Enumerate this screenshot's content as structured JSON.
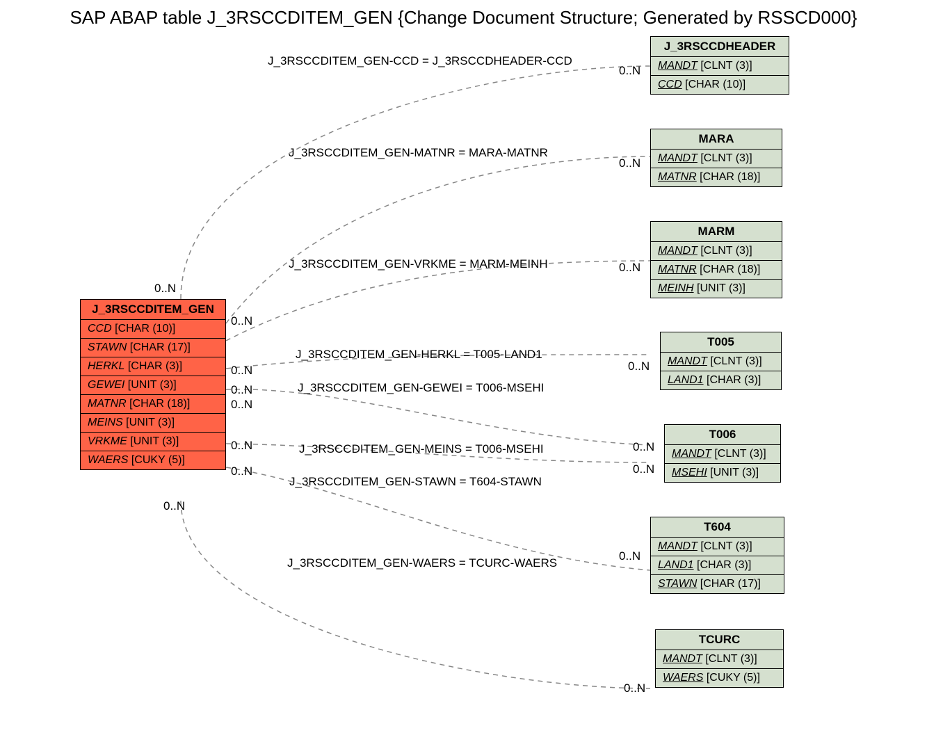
{
  "title": "SAP ABAP table J_3RSCCDITEM_GEN {Change Document Structure; Generated by RSSCD000}",
  "main": {
    "name": "J_3RSCCDITEM_GEN",
    "rows": [
      {
        "f": "CCD",
        "t": "[CHAR (10)]"
      },
      {
        "f": "STAWN",
        "t": "[CHAR (17)]"
      },
      {
        "f": "HERKL",
        "t": "[CHAR (3)]"
      },
      {
        "f": "GEWEI",
        "t": "[UNIT (3)]"
      },
      {
        "f": "MATNR",
        "t": "[CHAR (18)]"
      },
      {
        "f": "MEINS",
        "t": "[UNIT (3)]"
      },
      {
        "f": "VRKME",
        "t": "[UNIT (3)]"
      },
      {
        "f": "WAERS",
        "t": "[CUKY (5)]"
      }
    ]
  },
  "refs": [
    {
      "name": "J_3RSCCDHEADER",
      "rows": [
        {
          "f": "MANDT",
          "t": "[CLNT (3)]",
          "u": true
        },
        {
          "f": "CCD",
          "t": "[CHAR (10)]",
          "u": true
        }
      ]
    },
    {
      "name": "MARA",
      "rows": [
        {
          "f": "MANDT",
          "t": "[CLNT (3)]",
          "i": true,
          "u": true
        },
        {
          "f": "MATNR",
          "t": "[CHAR (18)]",
          "u": true
        }
      ]
    },
    {
      "name": "MARM",
      "rows": [
        {
          "f": "MANDT",
          "t": "[CLNT (3)]",
          "i": true,
          "u": true
        },
        {
          "f": "MATNR",
          "t": "[CHAR (18)]",
          "i": true,
          "u": true
        },
        {
          "f": "MEINH",
          "t": "[UNIT (3)]",
          "i": true,
          "u": true
        }
      ]
    },
    {
      "name": "T005",
      "rows": [
        {
          "f": "MANDT",
          "t": "[CLNT (3)]",
          "i": true,
          "u": true
        },
        {
          "f": "LAND1",
          "t": "[CHAR (3)]",
          "u": true
        }
      ]
    },
    {
      "name": "T006",
      "rows": [
        {
          "f": "MANDT",
          "t": "[CLNT (3)]",
          "i": true,
          "u": true
        },
        {
          "f": "MSEHI",
          "t": "[UNIT (3)]",
          "u": true
        }
      ]
    },
    {
      "name": "T604",
      "rows": [
        {
          "f": "MANDT",
          "t": "[CLNT (3)]",
          "i": true,
          "u": true
        },
        {
          "f": "LAND1",
          "t": "[CHAR (3)]",
          "i": true,
          "u": true
        },
        {
          "f": "STAWN",
          "t": "[CHAR (17)]",
          "u": true
        }
      ]
    },
    {
      "name": "TCURC",
      "rows": [
        {
          "f": "MANDT",
          "t": "[CLNT (3)]",
          "u": true
        },
        {
          "f": "WAERS",
          "t": "[CUKY (5)]",
          "u": true
        }
      ]
    }
  ],
  "rel": [
    "J_3RSCCDITEM_GEN-CCD = J_3RSCCDHEADER-CCD",
    "J_3RSCCDITEM_GEN-MATNR = MARA-MATNR",
    "J_3RSCCDITEM_GEN-VRKME = MARM-MEINH",
    "J_3RSCCDITEM_GEN-HERKL = T005-LAND1",
    "J_3RSCCDITEM_GEN-GEWEI = T006-MSEHI",
    "J_3RSCCDITEM_GEN-MEINS = T006-MSEHI",
    "J_3RSCCDITEM_GEN-STAWN = T604-STAWN",
    "J_3RSCCDITEM_GEN-WAERS = TCURC-WAERS"
  ],
  "card": "0..N"
}
